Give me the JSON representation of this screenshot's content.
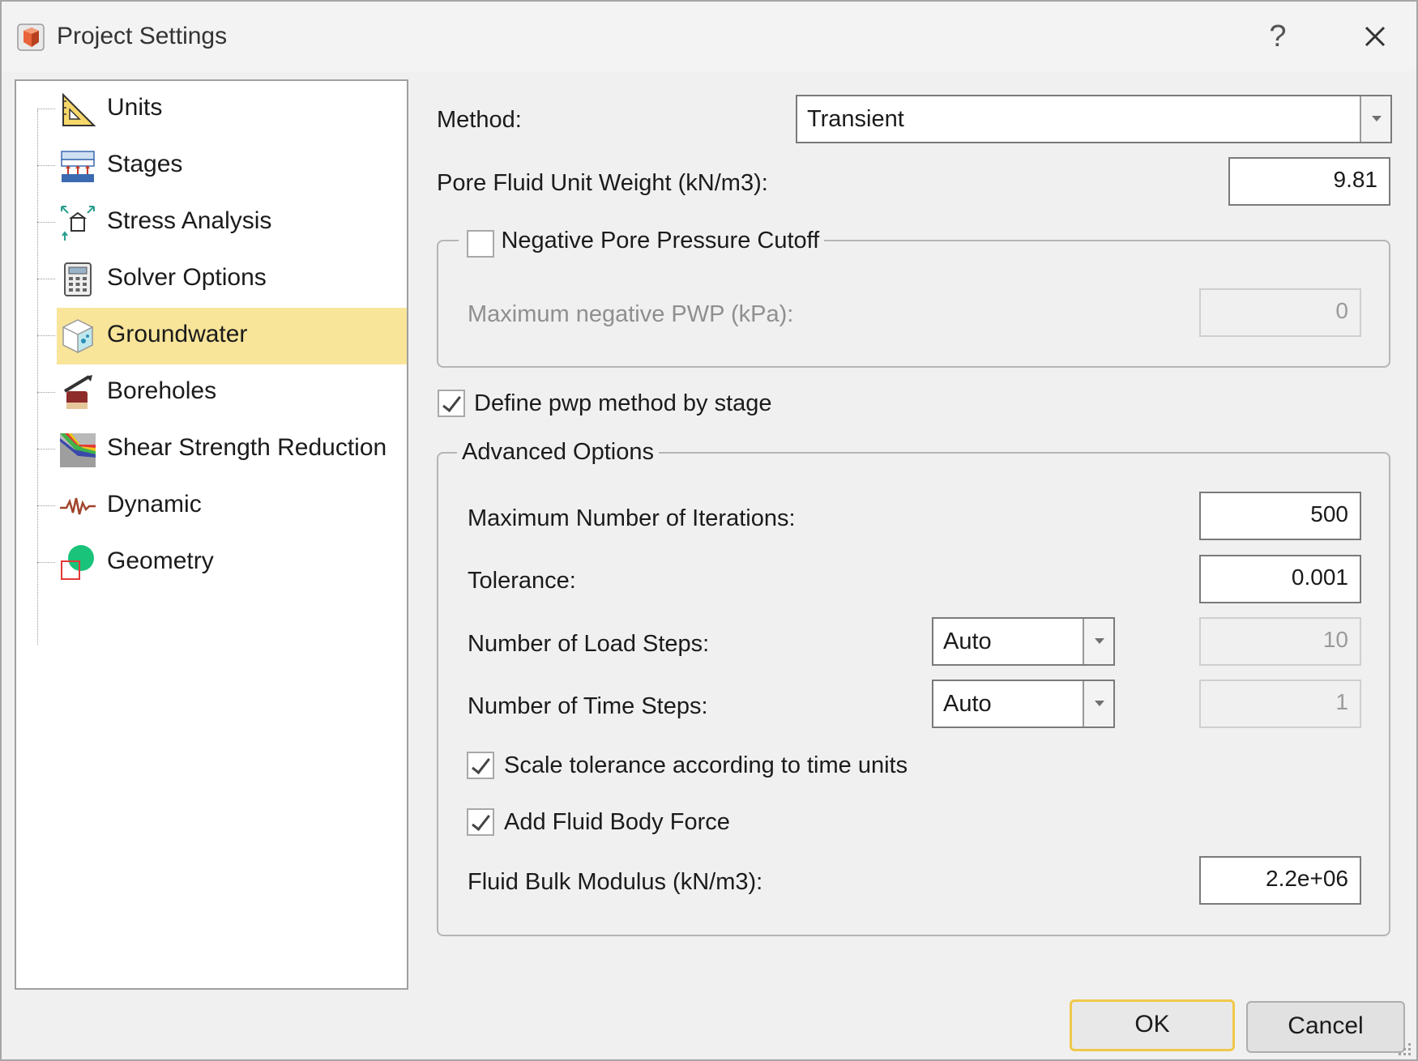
{
  "window": {
    "title": "Project Settings",
    "help_symbol": "?",
    "close_icon": "close-icon",
    "app_icon": "app-cube-icon"
  },
  "sidebar": {
    "items": [
      {
        "label": "Units",
        "icon": "ruler-triangle-icon",
        "selected": false
      },
      {
        "label": "Stages",
        "icon": "stages-icon",
        "selected": false
      },
      {
        "label": "Stress Analysis",
        "icon": "stress-analysis-icon",
        "selected": false
      },
      {
        "label": "Solver Options",
        "icon": "calculator-icon",
        "selected": false
      },
      {
        "label": "Groundwater",
        "icon": "groundwater-cube-icon",
        "selected": true
      },
      {
        "label": "Boreholes",
        "icon": "borehole-icon",
        "selected": false
      },
      {
        "label": "Shear Strength Reduction",
        "icon": "shear-strength-icon",
        "selected": false
      },
      {
        "label": "Dynamic",
        "icon": "dynamic-wave-icon",
        "selected": false
      },
      {
        "label": "Geometry",
        "icon": "geometry-shapes-icon",
        "selected": false
      }
    ],
    "selected_color": "#f8e59a"
  },
  "form": {
    "method": {
      "label": "Method:",
      "value": "Transient"
    },
    "pore_fluid_unit_weight": {
      "label": "Pore Fluid Unit Weight (kN/m3):",
      "value": "9.81"
    },
    "negative_cutoff": {
      "label": "Negative Pore Pressure Cutoff",
      "checked": false,
      "max_negative_pwp": {
        "label": "Maximum negative PWP (kPa):",
        "value": "0",
        "enabled": false
      }
    },
    "define_pwp_by_stage": {
      "label": "Define pwp method by stage",
      "checked": true
    },
    "advanced": {
      "legend": "Advanced Options",
      "max_iterations": {
        "label": "Maximum Number of Iterations:",
        "value": "500"
      },
      "tolerance": {
        "label": "Tolerance:",
        "value": "0.001"
      },
      "load_steps": {
        "label": "Number of Load Steps:",
        "mode": "Auto",
        "value": "10",
        "enabled": false
      },
      "time_steps": {
        "label": "Number of Time Steps:",
        "mode": "Auto",
        "value": "1",
        "enabled": false
      },
      "scale_tolerance": {
        "label": "Scale tolerance according to time units",
        "checked": true
      },
      "add_fluid_body_force": {
        "label": "Add Fluid Body Force",
        "checked": true
      },
      "fluid_bulk_modulus": {
        "label": "Fluid Bulk Modulus (kN/m3):",
        "value": "2.2e+06"
      }
    }
  },
  "buttons": {
    "ok": "OK",
    "cancel": "Cancel"
  },
  "colors": {
    "default_button_border": "#f0c84a",
    "dialog_bg": "#f0f0f0"
  }
}
